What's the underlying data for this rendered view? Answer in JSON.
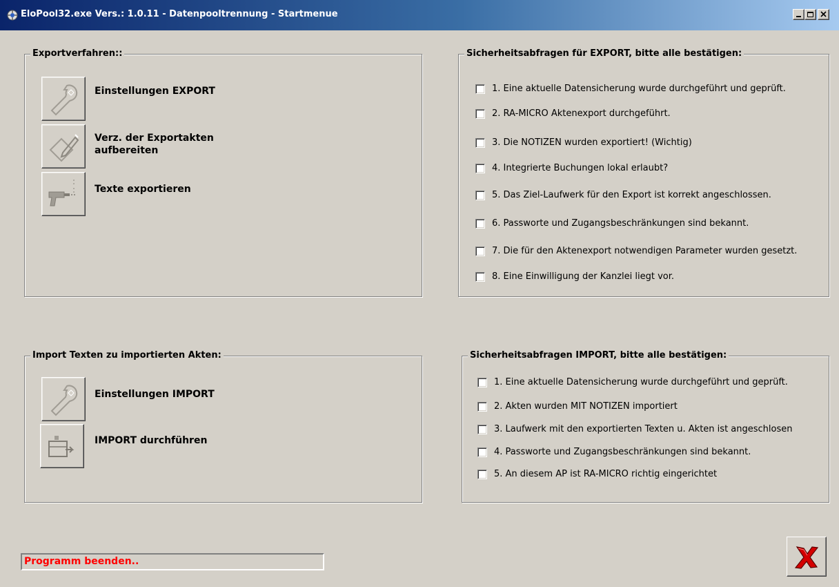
{
  "window": {
    "title": "EloPool32.exe Vers.: 1.0.11 - Datenpooltrennung - Startmenue"
  },
  "export_group": {
    "title": "Exportverfahren::",
    "buttons": [
      {
        "label": "Einstellungen EXPORT",
        "icon": "wrench-icon"
      },
      {
        "label_line1": "Verz. der Exportakten",
        "label_line2": "aufbereiten",
        "icon": "folder-pen-icon"
      },
      {
        "label": "Texte exportieren",
        "icon": "drill-icon"
      }
    ]
  },
  "export_checks": {
    "title": "Sicherheitsabfragen für EXPORT, bitte alle bestätigen:",
    "items": [
      {
        "label": "1. Eine aktuelle Datensicherung wurde durchgeführt und geprüft.",
        "checked": false
      },
      {
        "label": "2. RA-MICRO Aktenexport durchgeführt.",
        "checked": false
      },
      {
        "label": "3. Die NOTIZEN wurden exportiert! (Wichtig)",
        "checked": false
      },
      {
        "label": "4. Integrierte Buchungen lokal erlaubt?",
        "checked": false
      },
      {
        "label": "5. Das Ziel-Laufwerk für den Export ist korrekt angeschlossen.",
        "checked": false
      },
      {
        "label": "6. Passworte und Zugangsbeschränkungen sind bekannt.",
        "checked": false
      },
      {
        "label": "7. Die für den Aktenexport notwendigen Parameter wurden gesetzt.",
        "checked": false
      },
      {
        "label": "8. Eine Einwilligung der Kanzlei liegt vor.",
        "checked": false
      }
    ]
  },
  "import_group": {
    "title": "Import Texten zu importierten Akten:",
    "buttons": [
      {
        "label": "Einstellungen IMPORT",
        "icon": "wrench-icon"
      },
      {
        "label": "IMPORT durchführen",
        "icon": "import-icon"
      }
    ]
  },
  "import_checks": {
    "title": "Sicherheitsabfragen IMPORT, bitte alle bestätigen:",
    "items": [
      {
        "label": "1. Eine aktuelle Datensicherung wurde durchgeführt und geprüft.",
        "checked": false
      },
      {
        "label": "2. Akten wurden MIT NOTIZEN importiert",
        "checked": false
      },
      {
        "label": "3. Laufwerk mit den exportierten Texten u. Akten ist angeschlosen",
        "checked": false
      },
      {
        "label": "4. Passworte und Zugangsbeschränkungen sind bekannt.",
        "checked": false
      },
      {
        "label": "5. An diesem AP ist RA-MICRO richtig eingerichtet",
        "checked": false
      }
    ]
  },
  "status": {
    "text": "Programm beenden.."
  },
  "colors": {
    "status_text": "#ff0000",
    "exit_x": "#d40000",
    "face": "#d4d0c8"
  }
}
